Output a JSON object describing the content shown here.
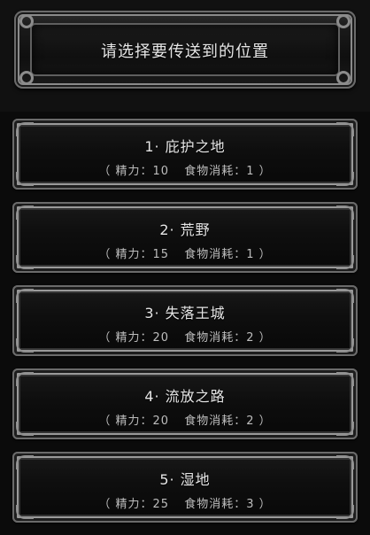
{
  "header": {
    "title": "请选择要传送到的位置"
  },
  "locations": [
    {
      "name": "1· 庇护之地",
      "stamina": "（ 精力：10",
      "food": "食物消耗：1 ）"
    },
    {
      "name": "2· 荒野",
      "stamina": "（ 精力：15",
      "food": "食物消耗：1 ）"
    },
    {
      "name": "3· 失落王城",
      "stamina": "（ 精力：20",
      "food": "食物消耗：2 ）"
    },
    {
      "name": "4· 流放之路",
      "stamina": "（ 精力：20",
      "food": "食物消耗：2 ）"
    },
    {
      "name": "5· 湿地",
      "stamina": "（ 精力：25",
      "food": "食物消耗：3 ）"
    }
  ]
}
